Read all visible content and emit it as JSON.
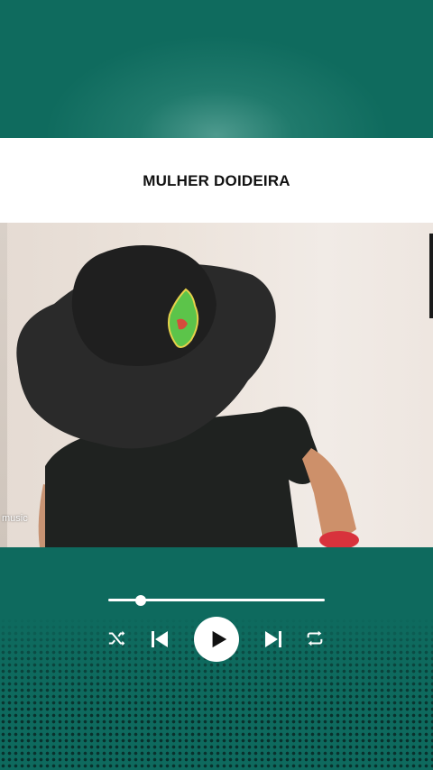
{
  "song": {
    "title": "MULHER DOIDEIRA"
  },
  "video": {
    "watermark": "music"
  },
  "player": {
    "progress_fraction": 0.15,
    "controls": [
      "shuffle-icon",
      "previous-icon",
      "play-icon",
      "next-icon",
      "repeat-icon"
    ]
  },
  "colors": {
    "background": "#0e6a5e",
    "title_band": "#ffffff",
    "controls": "#ffffff"
  }
}
